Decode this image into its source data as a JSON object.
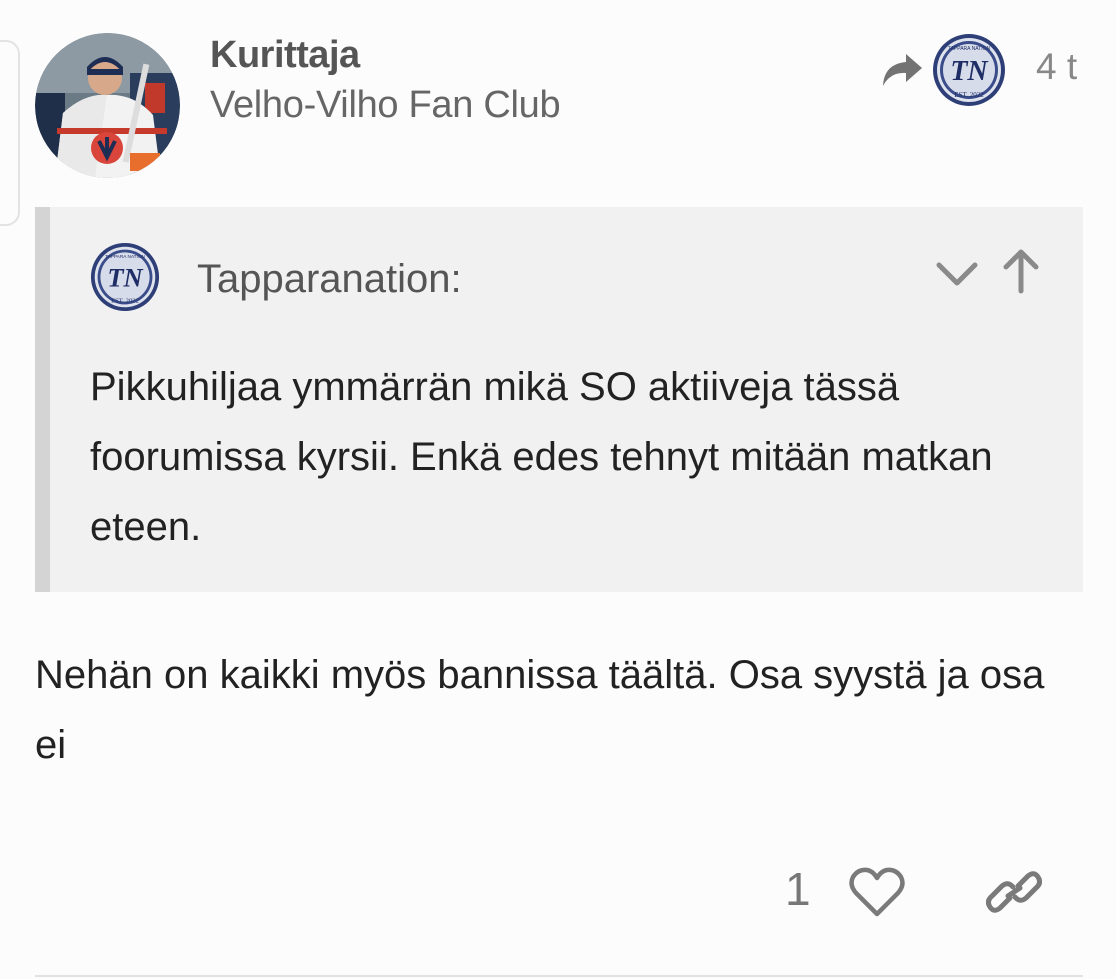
{
  "post": {
    "author": {
      "name": "Kurittaja",
      "title": "Velho-Vilho Fan Club",
      "avatar_icon": "avatar-photo-hockey-player"
    },
    "reply_to": {
      "icon": "share-reply-icon",
      "avatar_icon": "tapparanation-logo"
    },
    "date": "4 t",
    "quote": {
      "author": "Tapparanation:",
      "avatar_icon": "tapparanation-logo",
      "expand_icon": "chevron-down-icon",
      "goto_icon": "arrow-up-icon",
      "text": "Pikkuhiljaa ymmärrän mikä SO aktiiveja tässä foorumissa kyrsii. Enkä edes tehnyt mitään matkan eteen."
    },
    "body": "Nehän on kaikki myös bannissa täältä. Osa syystä ja osa ei",
    "actions": {
      "like_count": "1",
      "like_icon": "heart-icon",
      "link_icon": "link-icon"
    },
    "logo_text": {
      "initials": "TN",
      "est": "EST. 2022",
      "banner": "TAPPARA NATION"
    }
  }
}
